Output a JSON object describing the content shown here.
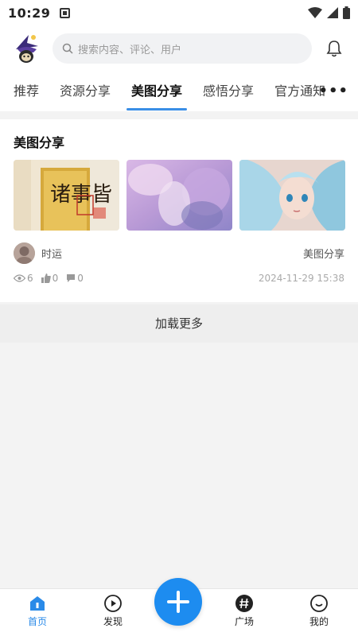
{
  "status_bar": {
    "time": "10:29"
  },
  "header": {
    "search_placeholder": "搜索内容、评论、用户",
    "icons": [
      "search-icon",
      "bell-icon"
    ]
  },
  "tabs": [
    {
      "label": "推荐"
    },
    {
      "label": "资源分享"
    },
    {
      "label": "美图分享",
      "active": true
    },
    {
      "label": "感悟分享"
    },
    {
      "label": "官方通知"
    }
  ],
  "tabs_more": "•••",
  "post": {
    "title": "美图分享",
    "author": "时运",
    "category": "美图分享",
    "views": "6",
    "likes": "0",
    "comments": "0",
    "date": "2024-11-29 15:38",
    "image1_text": "诸事皆"
  },
  "load_more": "加载更多",
  "bottom_nav": {
    "home": "首页",
    "discover": "发现",
    "plaza": "广场",
    "mine": "我的"
  },
  "colors": {
    "accent": "#1d8cf0",
    "tab_indicator": "#3a8ee6"
  }
}
